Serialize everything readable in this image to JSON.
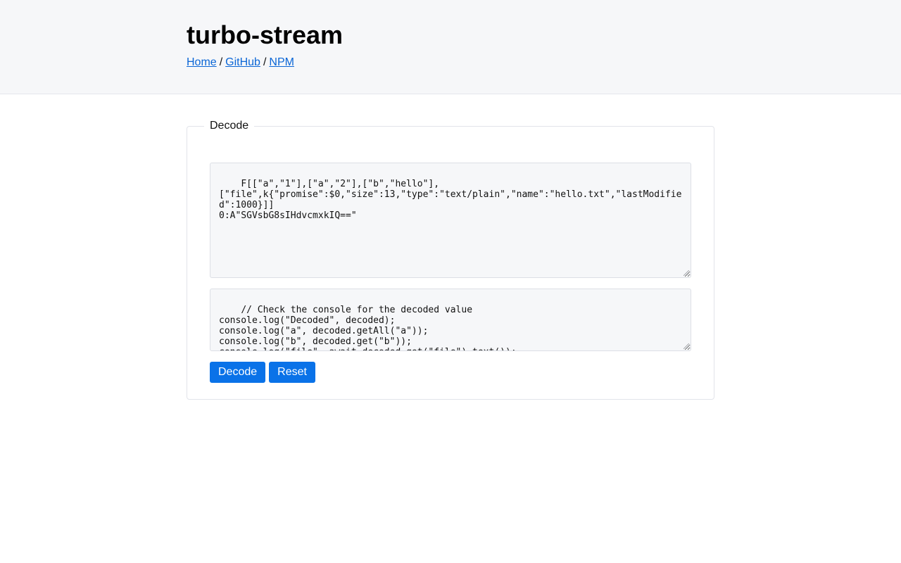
{
  "header": {
    "title": "turbo-stream",
    "breadcrumb": {
      "home": "Home",
      "github": "GitHub",
      "npm": "NPM",
      "separator": "/"
    }
  },
  "decode": {
    "legend": "Decode",
    "input_value": "F[[\"a\",\"1\"],[\"a\",\"2\"],[\"b\",\"hello\"],\n[\"file\",k{\"promise\":$0,\"size\":13,\"type\":\"text/plain\",\"name\":\"hello.txt\",\"lastModified\":1000}]]\n0:A\"SGVsbG8sIHdvcmxkIQ==\"",
    "script_value": "// Check the console for the decoded value\nconsole.log(\"Decoded\", decoded);\nconsole.log(\"a\", decoded.getAll(\"a\"));\nconsole.log(\"b\", decoded.get(\"b\"));\nconsole.log(\"file\", await decoded.get(\"file\").text());",
    "decode_button": "Decode",
    "reset_button": "Reset"
  },
  "colors": {
    "header_bg": "#f6f7f9",
    "link": "#0b66d6",
    "button_bg": "#0a72e8"
  }
}
